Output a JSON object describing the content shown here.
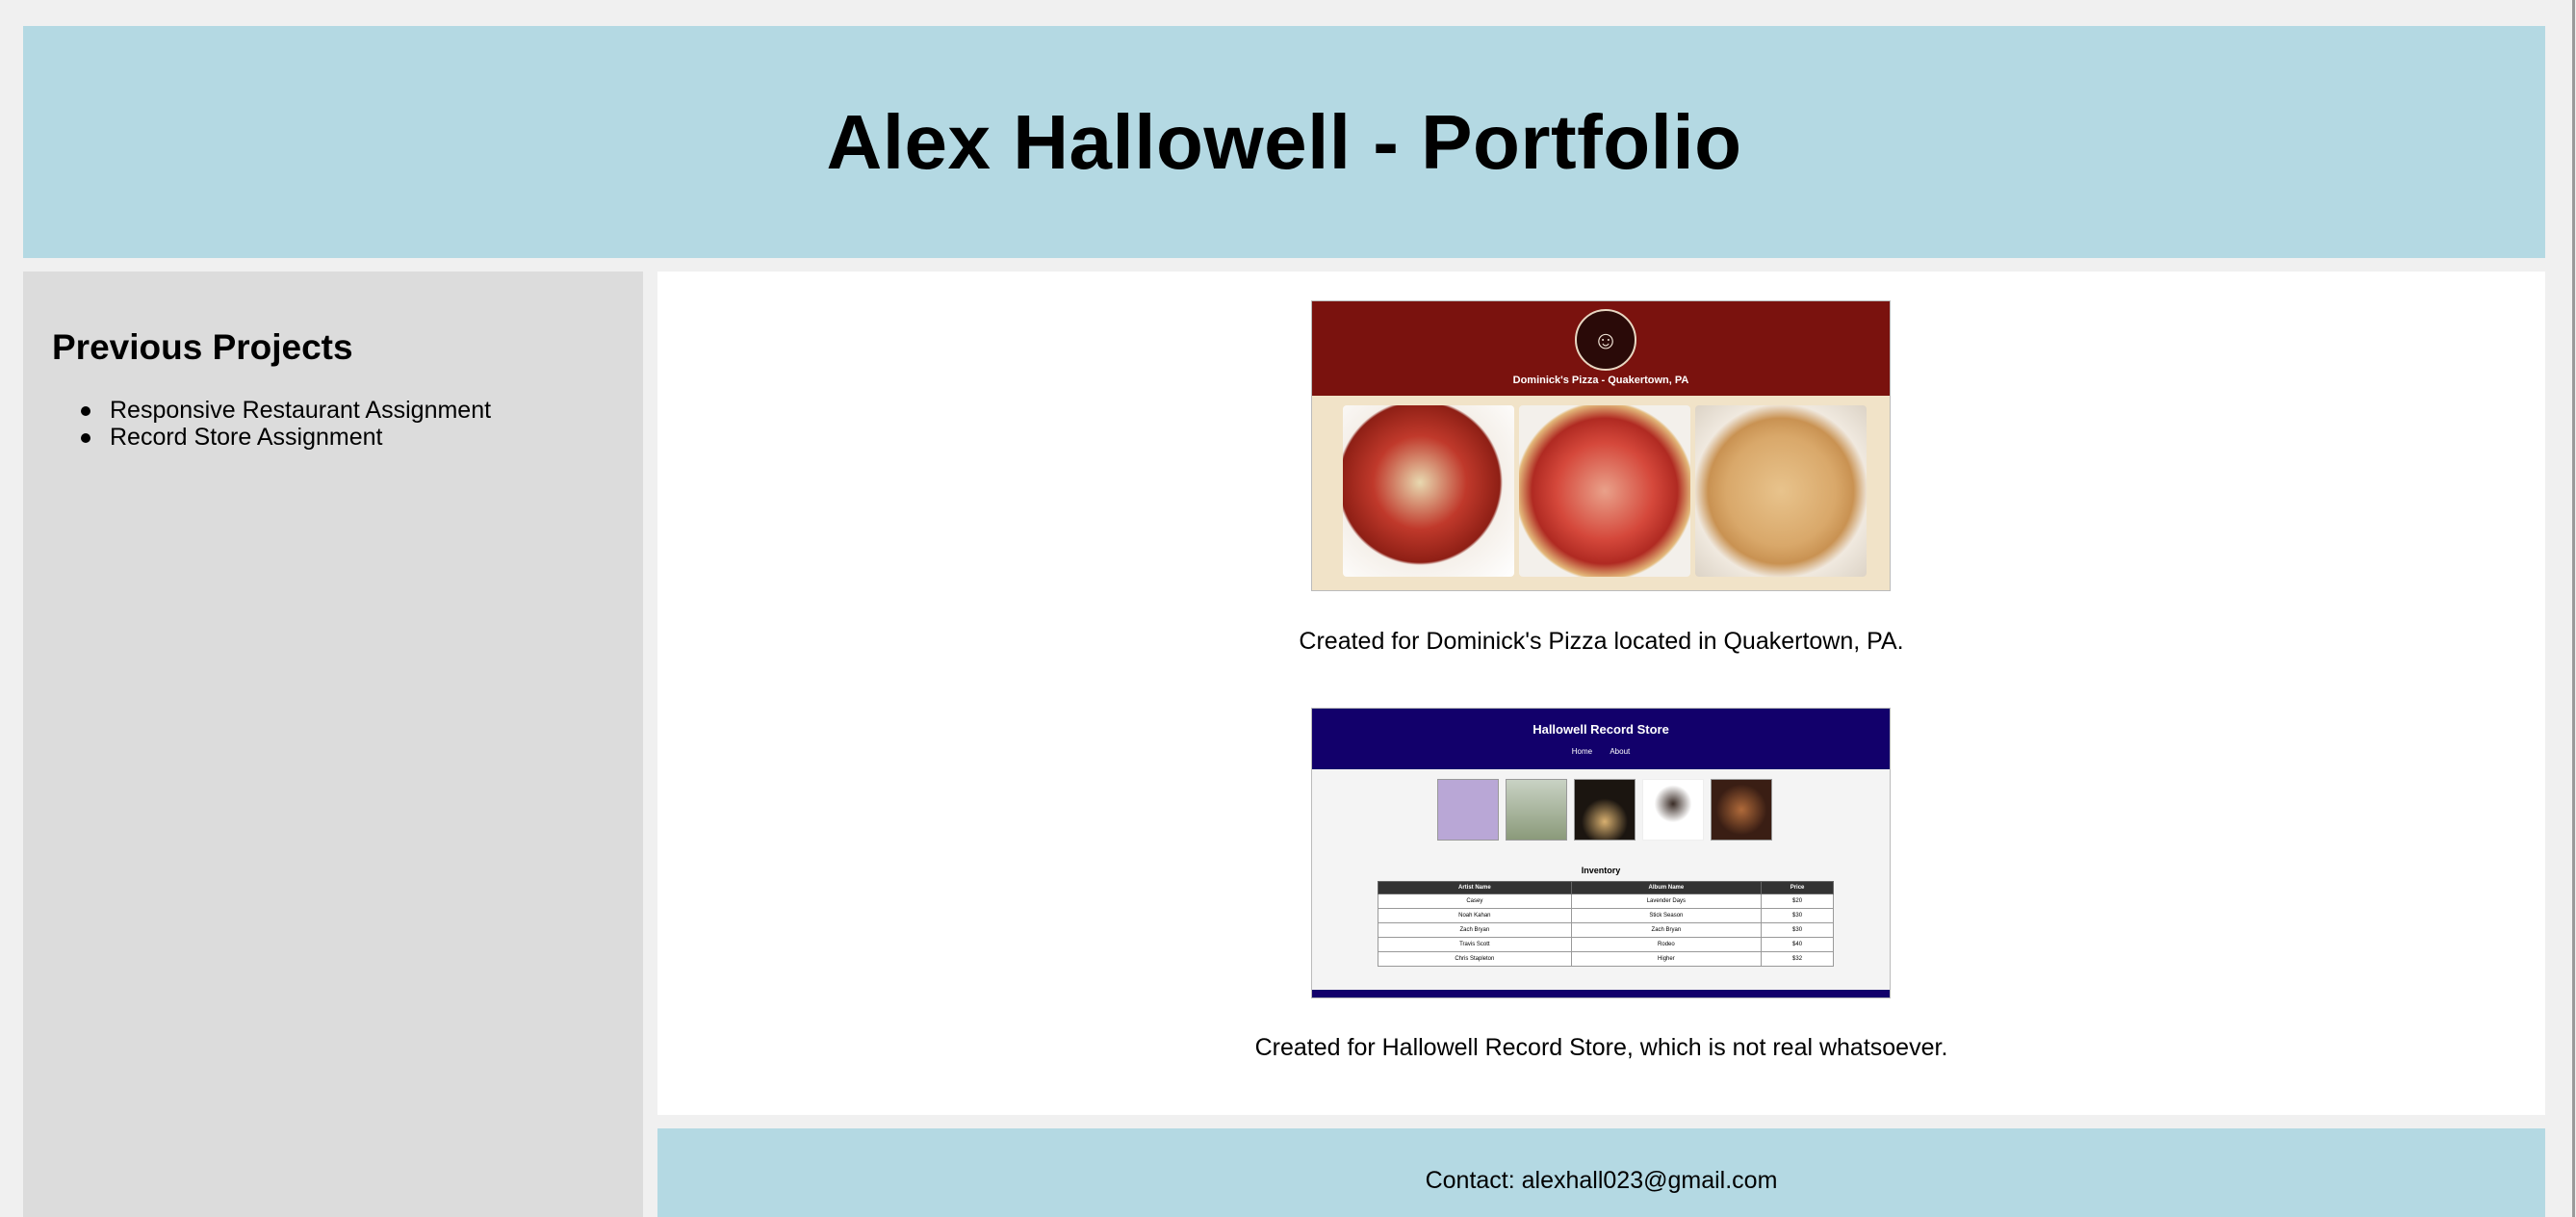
{
  "header": {
    "title": "Alex Hallowell - Portfolio"
  },
  "sidebar": {
    "heading": "Previous Projects",
    "items": [
      {
        "label": "Responsive Restaurant Assignment"
      },
      {
        "label": "Record Store Assignment"
      }
    ]
  },
  "projects": [
    {
      "screenshot": {
        "site_title": "Dominick's Pizza - Quakertown, PA",
        "logo_icon": "chef-logo-icon"
      },
      "caption": "Created for Dominick's Pizza located in Quakertown, PA."
    },
    {
      "screenshot": {
        "site_title": "Hallowell Record Store",
        "nav": [
          "Home",
          "About"
        ],
        "inventory_title": "Inventory",
        "columns": [
          "Artist Name",
          "Album Name",
          "Price"
        ],
        "rows": [
          [
            "Casey",
            "Lavender Days",
            "$20"
          ],
          [
            "Noah Kahan",
            "Stick Season",
            "$30"
          ],
          [
            "Zach Bryan",
            "Zach Bryan",
            "$30"
          ],
          [
            "Travis Scott",
            "Rodeo",
            "$40"
          ],
          [
            "Chris Stapleton",
            "Higher",
            "$32"
          ]
        ]
      },
      "caption": "Created for Hallowell Record Store, which is not real whatsoever."
    }
  ],
  "footer": {
    "contact": "Contact: alexhall023@gmail.com"
  },
  "colors": {
    "banner": "#b4d9e3",
    "sidebar": "#dcdcdc",
    "page_bg": "#f0f0f0",
    "pizza_header": "#7a120e",
    "record_header": "#12006b"
  }
}
